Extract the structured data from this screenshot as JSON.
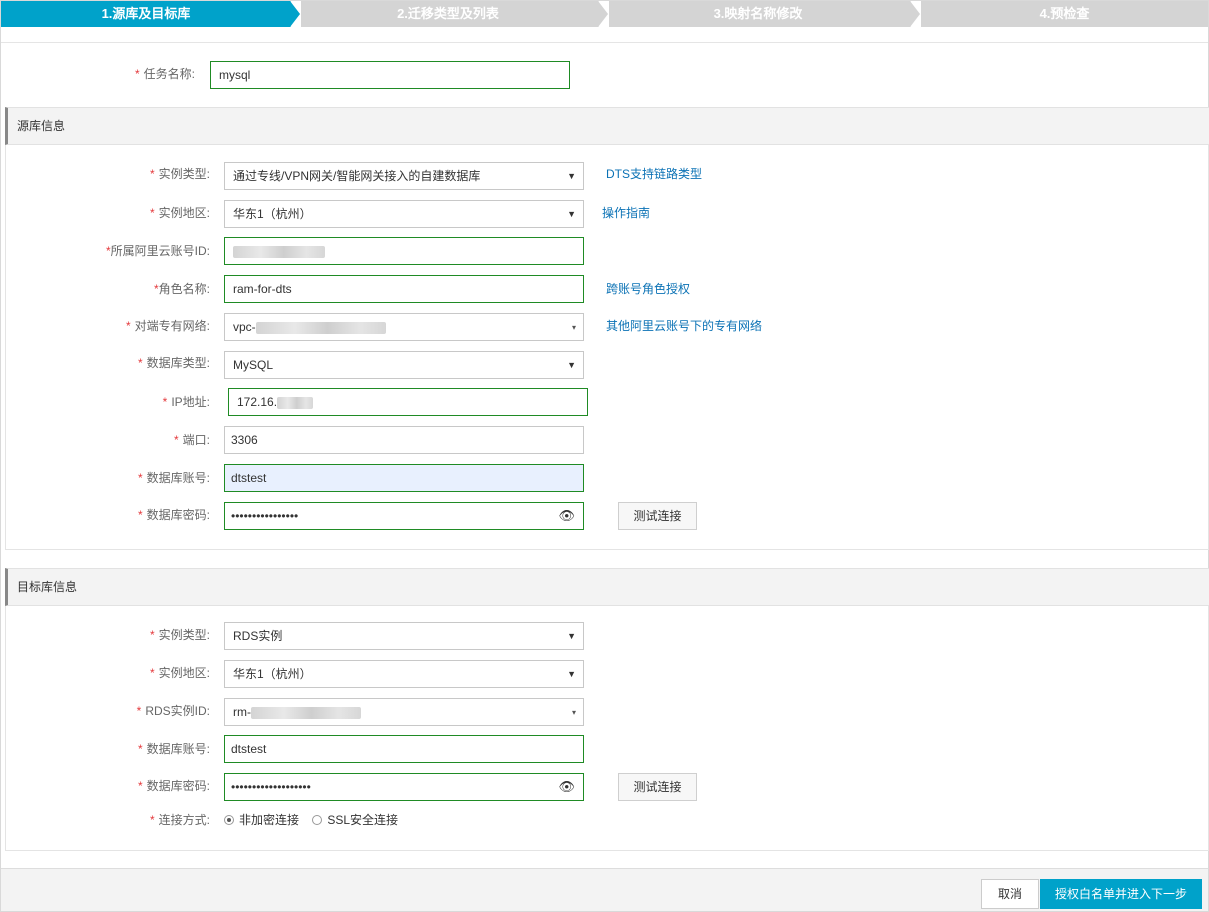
{
  "steps": [
    "1.源库及目标库",
    "2.迁移类型及列表",
    "3.映射名称修改",
    "4.预检查"
  ],
  "task": {
    "label": "任务名称:",
    "value": "mysql"
  },
  "source": {
    "title": "源库信息",
    "instance_type": {
      "label": "实例类型:",
      "value": "通过专线/VPN网关/智能网关接入的自建数据库",
      "link": "DTS支持链路类型"
    },
    "region": {
      "label": "实例地区:",
      "value": "华东1（杭州）",
      "link": "操作指南"
    },
    "account_id": {
      "label": "所属阿里云账号ID:"
    },
    "role": {
      "label": "角色名称:",
      "value": "ram-for-dts",
      "link": "跨账号角色授权"
    },
    "vpc": {
      "label": "对端专有网络:",
      "value_prefix": "vpc-",
      "link": "其他阿里云账号下的专有网络"
    },
    "db_type": {
      "label": "数据库类型:",
      "value": "MySQL"
    },
    "ip": {
      "label": "IP地址:",
      "value_prefix": "172.16."
    },
    "port": {
      "label": "端口:",
      "value": "3306"
    },
    "db_account": {
      "label": "数据库账号:",
      "value": "dtstest"
    },
    "db_password": {
      "label": "数据库密码:",
      "value": "••••••••••••••••"
    },
    "test_button": "测试连接"
  },
  "target": {
    "title": "目标库信息",
    "instance_type": {
      "label": "实例类型:",
      "value": "RDS实例"
    },
    "region": {
      "label": "实例地区:",
      "value": "华东1（杭州）"
    },
    "rds_id": {
      "label": "RDS实例ID:",
      "value_prefix": "rm-"
    },
    "db_account": {
      "label": "数据库账号:",
      "value": "dtstest"
    },
    "db_password": {
      "label": "数据库密码:",
      "value": "•••••••••••••••••••"
    },
    "test_button": "测试连接",
    "conn": {
      "label": "连接方式:",
      "options": [
        "非加密连接",
        "SSL安全连接"
      ],
      "selected": 0
    }
  },
  "footer": {
    "cancel": "取消",
    "next": "授权白名单并进入下一步"
  },
  "colors": {
    "accent": "#00a2ca",
    "valid_border": "#1f8b24",
    "required": "#e4393c",
    "link": "#0b72b5"
  }
}
